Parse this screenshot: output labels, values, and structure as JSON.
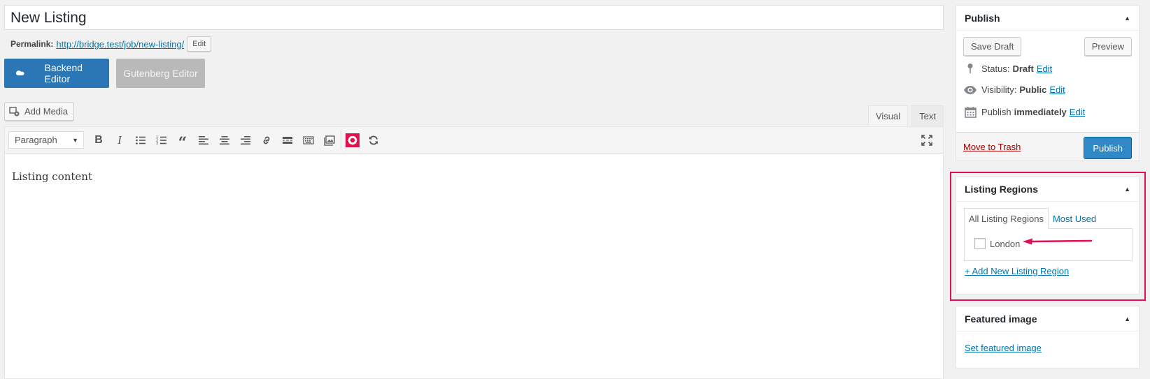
{
  "post": {
    "title": "New Listing",
    "permalink_label": "Permalink:",
    "permalink_url": "http://bridge.test/job/new-listing/",
    "permalink_edit": "Edit"
  },
  "builder": {
    "backend_label": "Backend Editor",
    "gutenberg_label": "Gutenberg Editor"
  },
  "editor": {
    "add_media_label": "Add Media",
    "tabs": [
      {
        "label": "Visual",
        "active": true
      },
      {
        "label": "Text",
        "active": false
      }
    ],
    "format_selected": "Paragraph",
    "toolbar_icons": [
      "bold-icon",
      "italic-icon",
      "bullet-list-icon",
      "numbered-list-icon",
      "blockquote-icon",
      "align-left-icon",
      "align-center-icon",
      "align-right-icon",
      "link-icon",
      "read-more-icon",
      "toolbar-toggle-icon",
      "image-gallery-icon",
      "record-icon",
      "refresh-icon",
      "fullscreen-icon"
    ],
    "content": "Listing content"
  },
  "publish": {
    "title": "Publish",
    "save_draft": "Save Draft",
    "preview": "Preview",
    "status_label": "Status:",
    "status_value": "Draft",
    "visibility_label": "Visibility:",
    "visibility_value": "Public",
    "publish_label": "Publish",
    "publish_value": "immediately",
    "edit": "Edit",
    "move_to_trash": "Move to Trash",
    "publish_button": "Publish"
  },
  "regions": {
    "title": "Listing Regions",
    "tab_all": "All Listing Regions",
    "tab_most_used": "Most Used",
    "items": [
      {
        "label": "London",
        "checked": false
      }
    ],
    "add_new": "+ Add New Listing Region"
  },
  "featured": {
    "title": "Featured image",
    "set_link": "Set featured image"
  },
  "colors": {
    "highlight": "#e0114f",
    "primary": "#2e89c6",
    "link": "#0073aa"
  }
}
